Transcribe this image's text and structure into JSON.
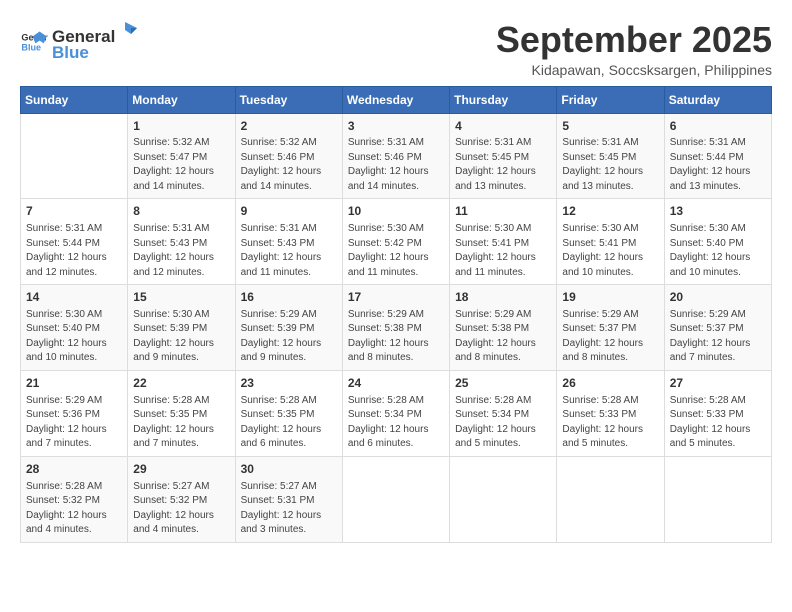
{
  "logo": {
    "line1": "General",
    "line2": "Blue"
  },
  "title": "September 2025",
  "subtitle": "Kidapawan, Soccsksargen, Philippines",
  "days_of_week": [
    "Sunday",
    "Monday",
    "Tuesday",
    "Wednesday",
    "Thursday",
    "Friday",
    "Saturday"
  ],
  "weeks": [
    [
      {
        "day": "",
        "info": ""
      },
      {
        "day": "1",
        "info": "Sunrise: 5:32 AM\nSunset: 5:47 PM\nDaylight: 12 hours\nand 14 minutes."
      },
      {
        "day": "2",
        "info": "Sunrise: 5:32 AM\nSunset: 5:46 PM\nDaylight: 12 hours\nand 14 minutes."
      },
      {
        "day": "3",
        "info": "Sunrise: 5:31 AM\nSunset: 5:46 PM\nDaylight: 12 hours\nand 14 minutes."
      },
      {
        "day": "4",
        "info": "Sunrise: 5:31 AM\nSunset: 5:45 PM\nDaylight: 12 hours\nand 13 minutes."
      },
      {
        "day": "5",
        "info": "Sunrise: 5:31 AM\nSunset: 5:45 PM\nDaylight: 12 hours\nand 13 minutes."
      },
      {
        "day": "6",
        "info": "Sunrise: 5:31 AM\nSunset: 5:44 PM\nDaylight: 12 hours\nand 13 minutes."
      }
    ],
    [
      {
        "day": "7",
        "info": "Sunrise: 5:31 AM\nSunset: 5:44 PM\nDaylight: 12 hours\nand 12 minutes."
      },
      {
        "day": "8",
        "info": "Sunrise: 5:31 AM\nSunset: 5:43 PM\nDaylight: 12 hours\nand 12 minutes."
      },
      {
        "day": "9",
        "info": "Sunrise: 5:31 AM\nSunset: 5:43 PM\nDaylight: 12 hours\nand 11 minutes."
      },
      {
        "day": "10",
        "info": "Sunrise: 5:30 AM\nSunset: 5:42 PM\nDaylight: 12 hours\nand 11 minutes."
      },
      {
        "day": "11",
        "info": "Sunrise: 5:30 AM\nSunset: 5:41 PM\nDaylight: 12 hours\nand 11 minutes."
      },
      {
        "day": "12",
        "info": "Sunrise: 5:30 AM\nSunset: 5:41 PM\nDaylight: 12 hours\nand 10 minutes."
      },
      {
        "day": "13",
        "info": "Sunrise: 5:30 AM\nSunset: 5:40 PM\nDaylight: 12 hours\nand 10 minutes."
      }
    ],
    [
      {
        "day": "14",
        "info": "Sunrise: 5:30 AM\nSunset: 5:40 PM\nDaylight: 12 hours\nand 10 minutes."
      },
      {
        "day": "15",
        "info": "Sunrise: 5:30 AM\nSunset: 5:39 PM\nDaylight: 12 hours\nand 9 minutes."
      },
      {
        "day": "16",
        "info": "Sunrise: 5:29 AM\nSunset: 5:39 PM\nDaylight: 12 hours\nand 9 minutes."
      },
      {
        "day": "17",
        "info": "Sunrise: 5:29 AM\nSunset: 5:38 PM\nDaylight: 12 hours\nand 8 minutes."
      },
      {
        "day": "18",
        "info": "Sunrise: 5:29 AM\nSunset: 5:38 PM\nDaylight: 12 hours\nand 8 minutes."
      },
      {
        "day": "19",
        "info": "Sunrise: 5:29 AM\nSunset: 5:37 PM\nDaylight: 12 hours\nand 8 minutes."
      },
      {
        "day": "20",
        "info": "Sunrise: 5:29 AM\nSunset: 5:37 PM\nDaylight: 12 hours\nand 7 minutes."
      }
    ],
    [
      {
        "day": "21",
        "info": "Sunrise: 5:29 AM\nSunset: 5:36 PM\nDaylight: 12 hours\nand 7 minutes."
      },
      {
        "day": "22",
        "info": "Sunrise: 5:28 AM\nSunset: 5:35 PM\nDaylight: 12 hours\nand 7 minutes."
      },
      {
        "day": "23",
        "info": "Sunrise: 5:28 AM\nSunset: 5:35 PM\nDaylight: 12 hours\nand 6 minutes."
      },
      {
        "day": "24",
        "info": "Sunrise: 5:28 AM\nSunset: 5:34 PM\nDaylight: 12 hours\nand 6 minutes."
      },
      {
        "day": "25",
        "info": "Sunrise: 5:28 AM\nSunset: 5:34 PM\nDaylight: 12 hours\nand 5 minutes."
      },
      {
        "day": "26",
        "info": "Sunrise: 5:28 AM\nSunset: 5:33 PM\nDaylight: 12 hours\nand 5 minutes."
      },
      {
        "day": "27",
        "info": "Sunrise: 5:28 AM\nSunset: 5:33 PM\nDaylight: 12 hours\nand 5 minutes."
      }
    ],
    [
      {
        "day": "28",
        "info": "Sunrise: 5:28 AM\nSunset: 5:32 PM\nDaylight: 12 hours\nand 4 minutes."
      },
      {
        "day": "29",
        "info": "Sunrise: 5:27 AM\nSunset: 5:32 PM\nDaylight: 12 hours\nand 4 minutes."
      },
      {
        "day": "30",
        "info": "Sunrise: 5:27 AM\nSunset: 5:31 PM\nDaylight: 12 hours\nand 3 minutes."
      },
      {
        "day": "",
        "info": ""
      },
      {
        "day": "",
        "info": ""
      },
      {
        "day": "",
        "info": ""
      },
      {
        "day": "",
        "info": ""
      }
    ]
  ]
}
